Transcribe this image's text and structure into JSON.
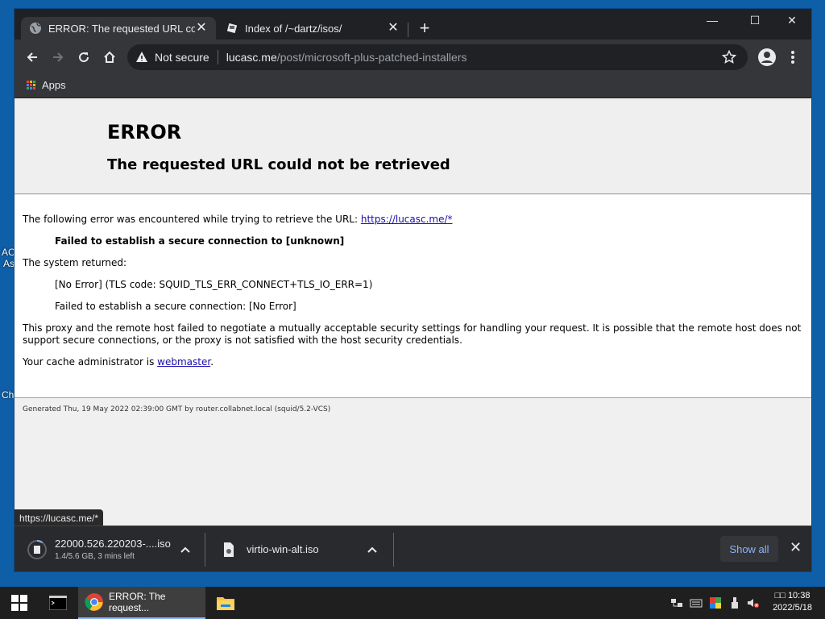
{
  "desktop": {
    "frag1": "AC",
    "frag2": "As",
    "frag3": "Ch"
  },
  "tabs": [
    {
      "title": "ERROR: The requested URL could not be retrieved",
      "close": "✕"
    },
    {
      "title": "Index of /~dartz/isos/",
      "close": "✕"
    }
  ],
  "new_tab": "+",
  "window_controls": {
    "minimize": "—",
    "maximize": "☐",
    "close": "✕"
  },
  "omnibox": {
    "security": "Not secure",
    "host": "lucasc.me",
    "path": "/post/microsoft-plus-patched-installers"
  },
  "bookmarks": {
    "apps": "Apps"
  },
  "page": {
    "h1": "ERROR",
    "h2": "The requested URL could not be retrieved",
    "intro": "The following error was encountered while trying to retrieve the URL: ",
    "intro_link": "https://lucasc.me/*",
    "failed": "Failed to establish a secure connection to [unknown]",
    "sys_returned": "The system returned:",
    "no_error": "[No Error] (TLS code: SQUID_TLS_ERR_CONNECT+TLS_IO_ERR=1)",
    "failed2": "Failed to establish a secure connection: [No Error]",
    "explain": "This proxy and the remote host failed to negotiate a mutually acceptable security settings for handling your request. It is possible that the remote host does not support secure connections, or the proxy is not satisfied with the host security credentials.",
    "admin_prefix": "Your cache administrator is ",
    "admin_link": "webmaster",
    "admin_suffix": ".",
    "footer": "Generated Thu, 19 May 2022 02:39:00 GMT by router.collabnet.local (squid/5.2-VCS)"
  },
  "status_url": "https://lucasc.me/*",
  "downloads": [
    {
      "name": "22000.526.220203-....iso",
      "status": "1.4/5.6 GB, 3 mins left"
    },
    {
      "name": "virtio-win-alt.iso"
    }
  ],
  "download_bar": {
    "show_all": "Show all",
    "close": "✕"
  },
  "taskbar": {
    "chrome_label": "ERROR: The request...",
    "time": "10:38",
    "ime": "□□",
    "date": "2022/5/18"
  },
  "colors": {
    "accent": "#8ab4f8",
    "link": "#1a0dab",
    "frame": "#202124",
    "toolbar": "#35363a"
  }
}
